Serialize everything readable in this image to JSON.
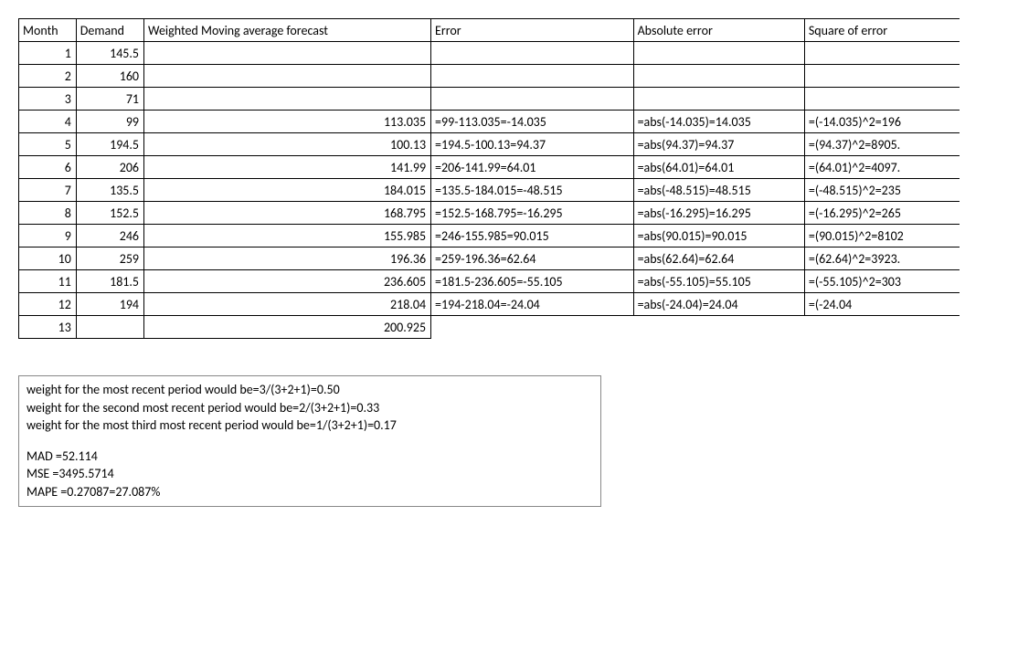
{
  "headers": {
    "month": "Month",
    "demand": "Demand",
    "forecast": "Weighted Moving average forecast",
    "error": "Error",
    "abs": "Absolute error",
    "sq": "Square of error"
  },
  "rows": [
    {
      "month": "1",
      "demand": "145.5",
      "forecast": "",
      "error": "",
      "abs": "",
      "sq": ""
    },
    {
      "month": "2",
      "demand": "160",
      "forecast": "",
      "error": "",
      "abs": "",
      "sq": ""
    },
    {
      "month": "3",
      "demand": "71",
      "forecast": "",
      "error": "",
      "abs": "",
      "sq": ""
    },
    {
      "month": "4",
      "demand": "99",
      "forecast": "113.035",
      "error": "=99-113.035=-14.035",
      "abs": "=abs(-14.035)=14.035",
      "sq": "=(-14.035)^2=196"
    },
    {
      "month": "5",
      "demand": "194.5",
      "forecast": "100.13",
      "error": "=194.5-100.13=94.37",
      "abs": "=abs(94.37)=94.37",
      "sq": "=(94.37)^2=8905."
    },
    {
      "month": "6",
      "demand": "206",
      "forecast": "141.99",
      "error": "=206-141.99=64.01",
      "abs": "=abs(64.01)=64.01",
      "sq": "=(64.01)^2=4097."
    },
    {
      "month": "7",
      "demand": "135.5",
      "forecast": "184.015",
      "error": "=135.5-184.015=-48.515",
      "abs": "=abs(-48.515)=48.515",
      "sq": "=(-48.515)^2=235"
    },
    {
      "month": "8",
      "demand": "152.5",
      "forecast": "168.795",
      "error": "=152.5-168.795=-16.295",
      "abs": "=abs(-16.295)=16.295",
      "sq": "=(-16.295)^2=265"
    },
    {
      "month": "9",
      "demand": "246",
      "forecast": "155.985",
      "error": "=246-155.985=90.015",
      "abs": "=abs(90.015)=90.015",
      "sq": "=(90.015)^2=8102"
    },
    {
      "month": "10",
      "demand": "259",
      "forecast": "196.36",
      "error": "=259-196.36=62.64",
      "abs": "=abs(62.64)=62.64",
      "sq": "=(62.64)^2=3923."
    },
    {
      "month": "11",
      "demand": "181.5",
      "forecast": "236.605",
      "error": "=181.5-236.605=-55.105",
      "abs": "=abs(-55.105)=55.105",
      "sq": "=(-55.105)^2=303"
    },
    {
      "month": "12",
      "demand": "194",
      "forecast": "218.04",
      "error": "=194-218.04=-24.04",
      "abs": "=abs(-24.04)=24.04",
      "sq": "=(-24.04"
    },
    {
      "month": "13",
      "demand": "",
      "forecast": "200.925",
      "error": "",
      "abs": "",
      "sq": ""
    }
  ],
  "notes": {
    "w1": "weight for the most recent period would be=3/(3+2+1)=0.50",
    "w2": "weight for the second most recent period would be=2/(3+2+1)=0.33",
    "w3": "weight for the most third most recent period would be=1/(3+2+1)=0.17",
    "mad": "MAD =52.114",
    "mse": "MSE =3495.5714",
    "mape": "MAPE =0.27087=27.087%"
  }
}
